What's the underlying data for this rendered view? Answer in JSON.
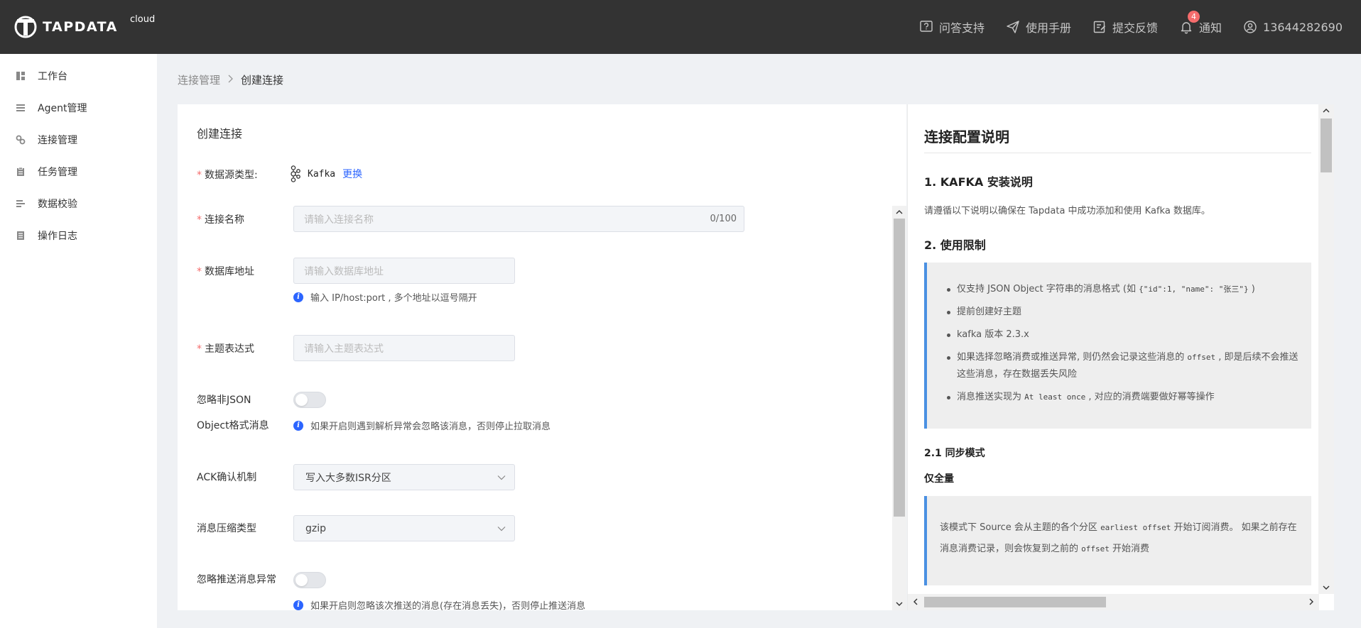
{
  "app": {
    "brand": "TAPDATA",
    "brand_sub": "cloud"
  },
  "header": {
    "items": [
      {
        "label": "问答支持",
        "icon": "help-icon"
      },
      {
        "label": "使用手册",
        "icon": "manual-icon"
      },
      {
        "label": "提交反馈",
        "icon": "feedback-icon"
      },
      {
        "label": "通知",
        "icon": "bell-icon",
        "badge": "4"
      },
      {
        "label": "13644282690",
        "icon": "user-icon"
      }
    ]
  },
  "sidebar": {
    "items": [
      {
        "label": "工作台",
        "icon": "dashboard-icon"
      },
      {
        "label": "Agent管理",
        "icon": "agent-list-icon"
      },
      {
        "label": "连接管理",
        "icon": "link-icon"
      },
      {
        "label": "任务管理",
        "icon": "task-icon"
      },
      {
        "label": "数据校验",
        "icon": "verify-icon"
      },
      {
        "label": "操作日志",
        "icon": "log-icon"
      }
    ]
  },
  "breadcrumb": {
    "parent": "连接管理",
    "separator": ">",
    "current": "创建连接"
  },
  "form": {
    "title": "创建连接",
    "datasource_label": "数据源类型:",
    "datasource_name": "Kafka",
    "datasource_change": "更换",
    "name_label": "连接名称",
    "name_placeholder": "请输入连接名称",
    "name_counter": "0/100",
    "db_label": "数据库地址",
    "db_placeholder": "请输入数据库地址",
    "db_hint": "输入 IP/host:port , 多个地址以逗号隔开",
    "topic_label": "主题表达式",
    "topic_placeholder": "请输入主题表达式",
    "ignore_json_label_1": "忽略非JSON",
    "ignore_json_label_2": "Object格式消息",
    "ignore_json_hint": "如果开启则遇到解析异常会忽略该消息，否则停止拉取消息",
    "ack_label": "ACK确认机制",
    "ack_value": "写入大多数ISR分区",
    "compress_label": "消息压缩类型",
    "compress_value": "gzip",
    "ignore_push_label": "忽略推送消息异常",
    "ignore_push_hint": "如果开启则忽略该次推送的消息(存在消息丢失)，否则停止推送消息"
  },
  "doc": {
    "title": "连接配置说明",
    "s1_title": "1. KAFKA 安装说明",
    "s1_text": "请遵循以下说明以确保在 Tapdata 中成功添加和使用 Kafka 数据库。",
    "s2_title": "2. 使用限制",
    "limit1_pre": "仅支持 JSON Object 字符串的消息格式 (如",
    "limit1_code": "{\"id\":1, \"name\": \"张三\"}",
    "limit1_post": ")",
    "limit2": "提前创建好主题",
    "limit3": "kafka 版本 2.3.x",
    "limit4_pre": "如果选择忽略消费或推送异常, 则仍然会记录这些消息的",
    "limit4_code": "offset",
    "limit4_post": ", 即是后续不会推送这些消息，存在数据丢失风险",
    "limit5_pre": "消息推送实现为",
    "limit5_code": "At least once",
    "limit5_post": ", 对应的消费端要做好幂等操作",
    "s21_title": "2.1 同步模式",
    "s21_sub": "仅全量",
    "full_pre": "该模式下 Source 会从主题的各个分区",
    "full_code1": "earliest offset",
    "full_mid": "开始订阅消费。 如果之前存在消息消费记录，则会恢复到之前的",
    "full_code2": "offset",
    "full_post": "开始消费"
  }
}
